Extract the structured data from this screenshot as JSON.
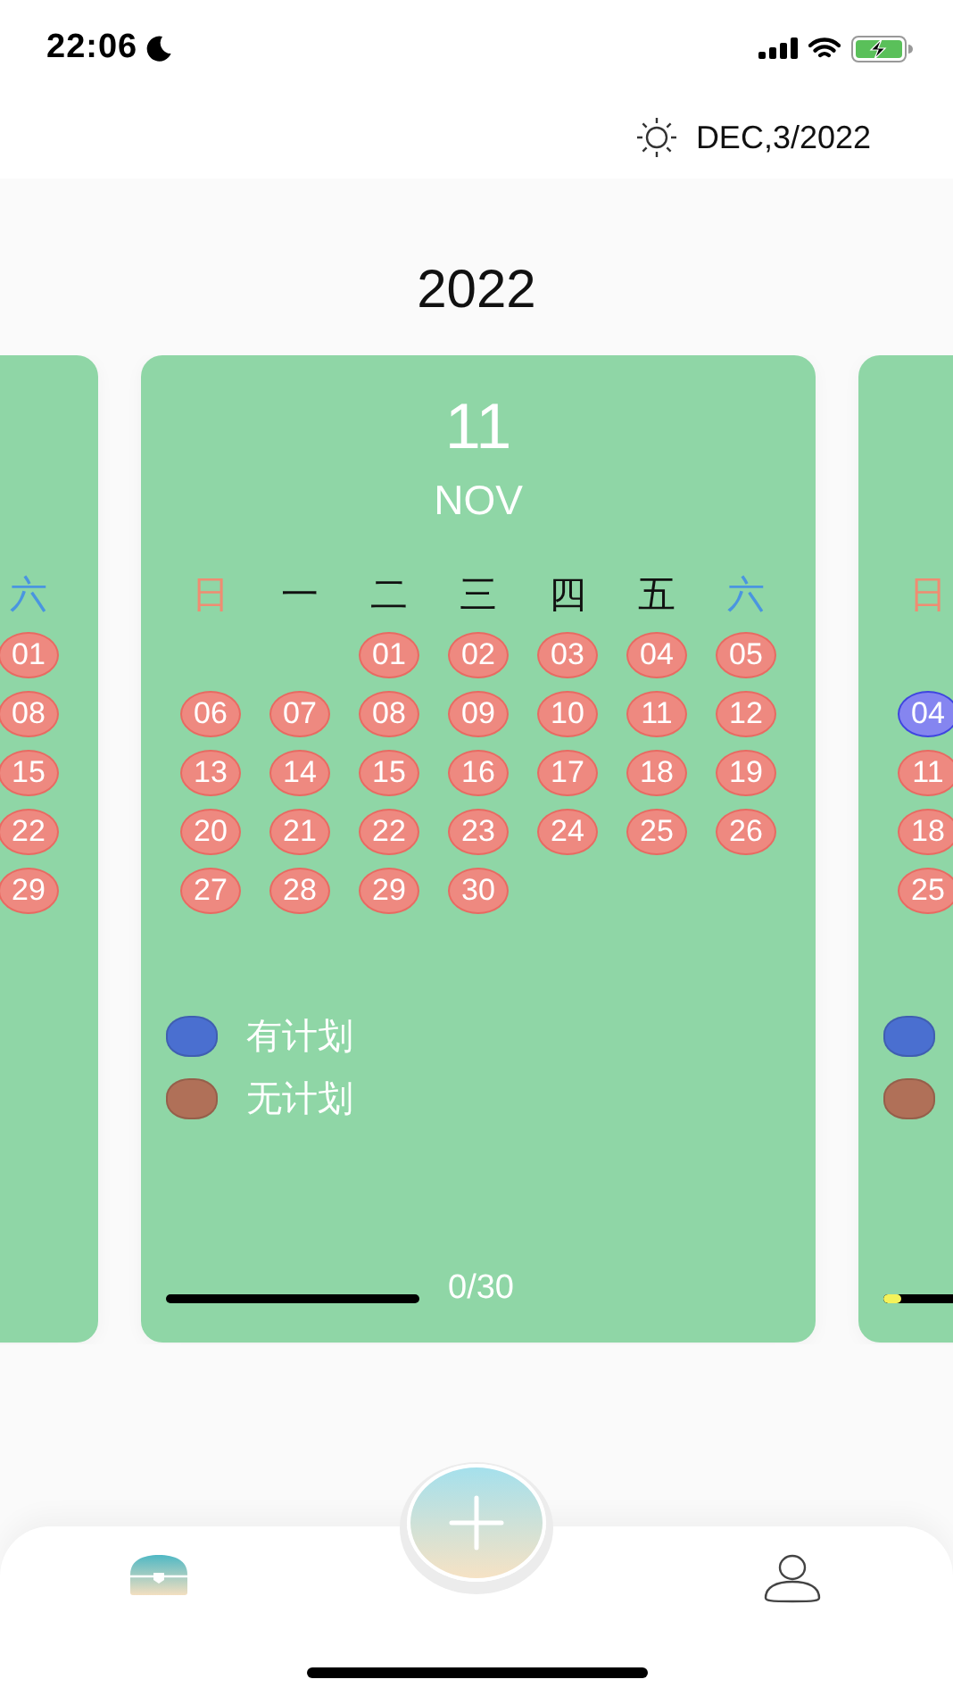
{
  "status_bar": {
    "time": "22:06"
  },
  "header": {
    "date": "DEC,3/2022"
  },
  "year": "2022",
  "cards": [
    {
      "kind": "left-edge",
      "weekdays": [
        {
          "label": "六",
          "kind": "saturday"
        }
      ],
      "weeks": [
        [
          {
            "day": "01",
            "planned": false
          }
        ],
        [
          {
            "day": "08",
            "planned": false
          }
        ],
        [
          {
            "day": "15",
            "planned": false
          }
        ],
        [
          {
            "day": "22",
            "planned": false
          }
        ],
        [
          {
            "day": "29",
            "planned": false
          }
        ]
      ]
    },
    {
      "kind": "full",
      "number": "11",
      "month": "NOV",
      "weekdays": [
        {
          "label": "日",
          "kind": "sunday"
        },
        {
          "label": "一",
          "kind": "weekday"
        },
        {
          "label": "二",
          "kind": "weekday"
        },
        {
          "label": "三",
          "kind": "weekday"
        },
        {
          "label": "四",
          "kind": "weekday"
        },
        {
          "label": "五",
          "kind": "weekday"
        },
        {
          "label": "六",
          "kind": "saturday"
        }
      ],
      "weeks": [
        [
          {
            "kind": "blank"
          },
          {
            "kind": "blank"
          },
          {
            "day": "01",
            "planned": false
          },
          {
            "day": "02",
            "planned": false
          },
          {
            "day": "03",
            "planned": false
          },
          {
            "day": "04",
            "planned": false
          },
          {
            "day": "05",
            "planned": false
          }
        ],
        [
          {
            "day": "06",
            "planned": false
          },
          {
            "day": "07",
            "planned": false
          },
          {
            "day": "08",
            "planned": false
          },
          {
            "day": "09",
            "planned": false
          },
          {
            "day": "10",
            "planned": false
          },
          {
            "day": "11",
            "planned": false
          },
          {
            "day": "12",
            "planned": false
          }
        ],
        [
          {
            "day": "13",
            "planned": false
          },
          {
            "day": "14",
            "planned": false
          },
          {
            "day": "15",
            "planned": false
          },
          {
            "day": "16",
            "planned": false
          },
          {
            "day": "17",
            "planned": false
          },
          {
            "day": "18",
            "planned": false
          },
          {
            "day": "19",
            "planned": false
          }
        ],
        [
          {
            "day": "20",
            "planned": false
          },
          {
            "day": "21",
            "planned": false
          },
          {
            "day": "22",
            "planned": false
          },
          {
            "day": "23",
            "planned": false
          },
          {
            "day": "24",
            "planned": false
          },
          {
            "day": "25",
            "planned": false
          },
          {
            "day": "26",
            "planned": false
          }
        ],
        [
          {
            "day": "27",
            "planned": false
          },
          {
            "day": "28",
            "planned": false
          },
          {
            "day": "29",
            "planned": false
          },
          {
            "day": "30",
            "planned": false
          }
        ]
      ],
      "legend": [
        {
          "label": "有计划",
          "color": "#4a6fd0"
        },
        {
          "label": "无计划",
          "color": "#b07058"
        }
      ],
      "progress": {
        "level": 0,
        "text": "0/30"
      }
    },
    {
      "kind": "right-edge",
      "weekdays": [
        {
          "label": "日",
          "kind": "sunday"
        }
      ],
      "weeks": [
        [
          {
            "kind": "blank"
          }
        ],
        [
          {
            "day": "04",
            "planned": true
          }
        ],
        [
          {
            "day": "11",
            "planned": false
          }
        ],
        [
          {
            "day": "18",
            "planned": false
          }
        ],
        [
          {
            "day": "25",
            "planned": false
          }
        ]
      ],
      "legend": [
        {
          "color": "#4a6fd0"
        },
        {
          "color": "#b07058"
        }
      ],
      "progress": {
        "level": 0.03
      }
    }
  ],
  "tabs": [
    {
      "selected": true
    },
    {
      "selected": false
    }
  ]
}
